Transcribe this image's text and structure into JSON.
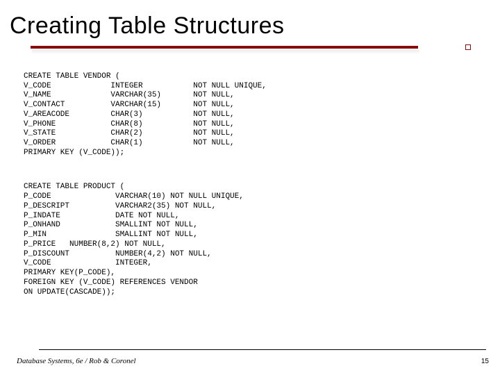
{
  "title": "Creating Table Structures",
  "code_block_1": "CREATE TABLE VENDOR (\nV_CODE             INTEGER           NOT NULL UNIQUE,\nV_NAME             VARCHAR(35)       NOT NULL,\nV_CONTACT          VARCHAR(15)       NOT NULL,\nV_AREACODE         CHAR(3)           NOT NULL,\nV_PHONE            CHAR(8)           NOT NULL,\nV_STATE            CHAR(2)           NOT NULL,\nV_ORDER            CHAR(1)           NOT NULL,\nPRIMARY KEY (V_CODE));",
  "code_block_2": "CREATE TABLE PRODUCT (\nP_CODE              VARCHAR(10) NOT NULL UNIQUE,\nP_DESCRIPT          VARCHAR2(35) NOT NULL,\nP_INDATE            DATE NOT NULL,\nP_ONHAND            SMALLINT NOT NULL,\nP_MIN               SMALLINT NOT NULL,\nP_PRICE   NUMBER(8,2) NOT NULL,\nP_DISCOUNT          NUMBER(4,2) NOT NULL,\nV_CODE              INTEGER,\nPRIMARY KEY(P_CODE),\nFOREIGN KEY (V_CODE) REFERENCES VENDOR\nON UPDATE(CASCADE));",
  "footer": "Database Systems, 6e / Rob & Coronel",
  "page_number": "15"
}
